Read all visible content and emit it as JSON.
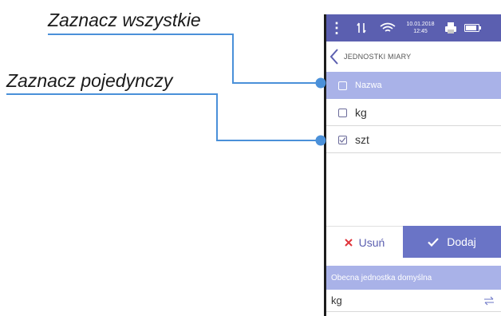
{
  "annotations": {
    "select_all": "Zaznacz wszystkie",
    "select_single": "Zaznacz pojedynczy"
  },
  "statusbar": {
    "date": "10.01.2018",
    "time": "12:45"
  },
  "screen": {
    "title": "JEDNOSTKI MIARY"
  },
  "list": {
    "header_label": "Nazwa",
    "items": [
      {
        "label": "kg",
        "checked": false
      },
      {
        "label": "szt",
        "checked": true
      }
    ]
  },
  "actions": {
    "remove_label": "Usuń",
    "add_label": "Dodaj"
  },
  "default_unit": {
    "header": "Obecna jednostka domyślna",
    "value": "kg"
  },
  "colors": {
    "primary": "#5b5fb0",
    "header_bg": "#a9b2e8",
    "add_button": "#6a74c6",
    "remove_icon": "#e0353b",
    "callout": "#4a90d9"
  },
  "icons": [
    "menu-dots-icon",
    "signal-icon",
    "wifi-icon",
    "printer-icon",
    "battery-icon",
    "back-arrow-icon",
    "checkbox-icon",
    "close-icon",
    "checkmark-icon",
    "swap-icon"
  ]
}
